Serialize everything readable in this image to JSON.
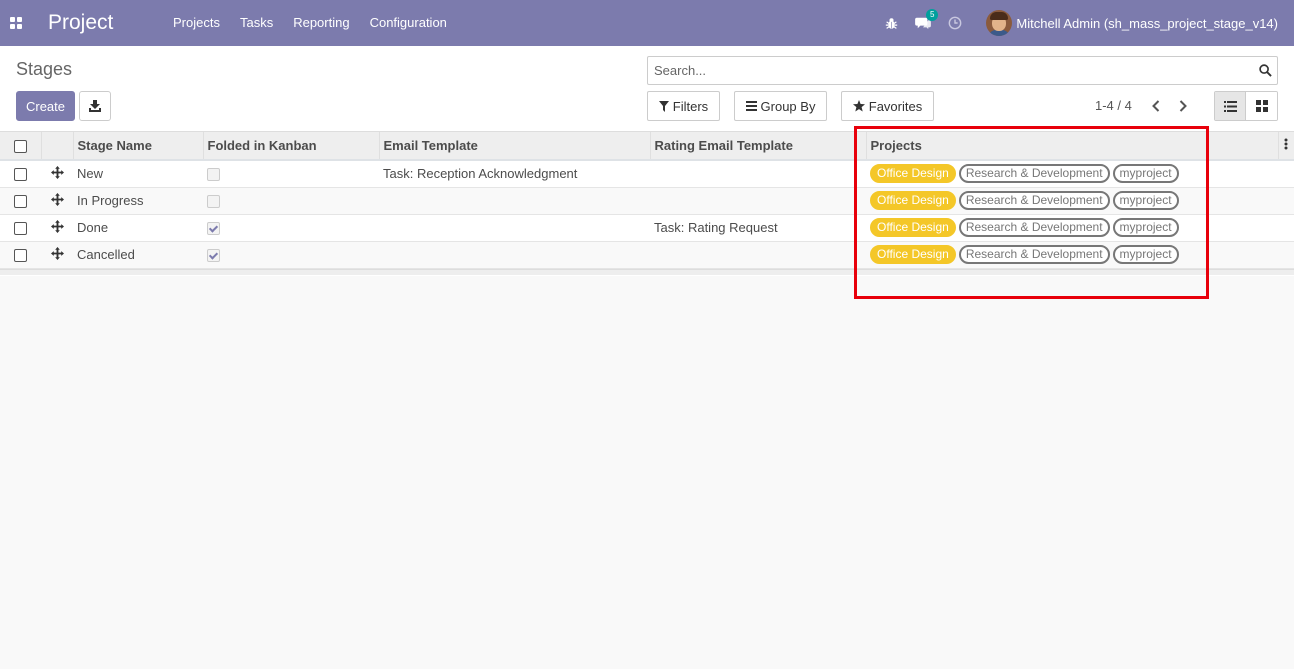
{
  "navbar": {
    "app_name": "Project",
    "menu": [
      {
        "label": "Projects"
      },
      {
        "label": "Tasks"
      },
      {
        "label": "Reporting"
      },
      {
        "label": "Configuration"
      }
    ],
    "messages_count": "5",
    "user_name": "Mitchell Admin (sh_mass_project_stage_v14)"
  },
  "control_panel": {
    "breadcrumb": "Stages",
    "create_label": "Create",
    "search_placeholder": "Search...",
    "filters_label": "Filters",
    "group_by_label": "Group By",
    "favorites_label": "Favorites",
    "pager": "1-4 / 4"
  },
  "table": {
    "columns": [
      "Stage Name",
      "Folded in Kanban",
      "Email Template",
      "Rating Email Template",
      "Projects"
    ],
    "rows": [
      {
        "stage_name": "New",
        "folded": false,
        "email_template": "Task: Reception Acknowledgment",
        "rating_template": "",
        "projects": [
          "Office Design",
          "Research & Development",
          "myproject"
        ]
      },
      {
        "stage_name": "In Progress",
        "folded": false,
        "email_template": "",
        "rating_template": "",
        "projects": [
          "Office Design",
          "Research & Development",
          "myproject"
        ]
      },
      {
        "stage_name": "Done",
        "folded": true,
        "email_template": "",
        "rating_template": "Task: Rating Request",
        "projects": [
          "Office Design",
          "Research & Development",
          "myproject"
        ]
      },
      {
        "stage_name": "Cancelled",
        "folded": true,
        "email_template": "",
        "rating_template": "",
        "projects": [
          "Office Design",
          "Research & Development",
          "myproject"
        ]
      }
    ]
  },
  "colors": {
    "brand": "#7c7bad",
    "tag_yellow": "#f4c728",
    "highlight": "#e8000b",
    "badge": "#00a09d"
  }
}
